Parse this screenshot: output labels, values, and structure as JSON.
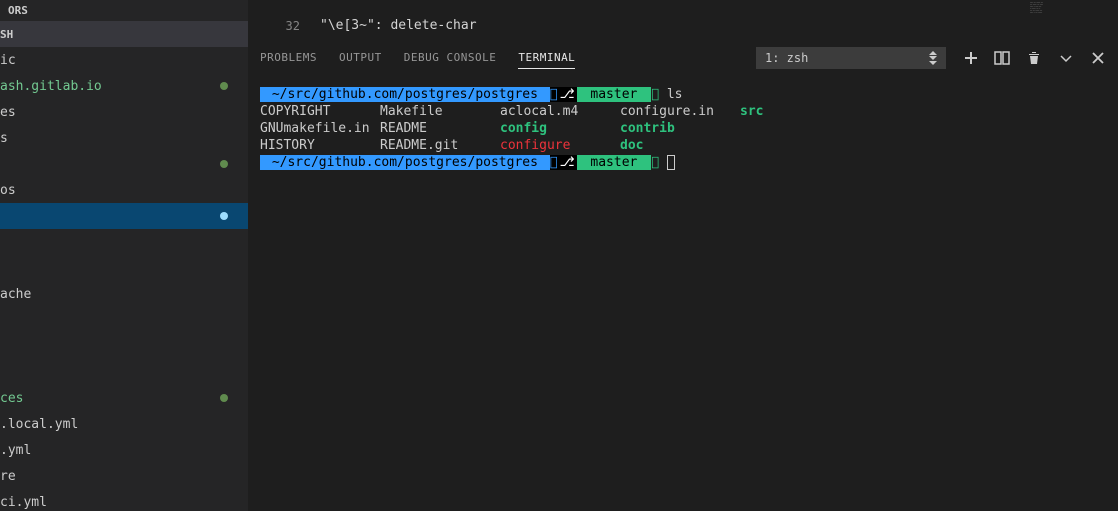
{
  "sidebar": {
    "section_ors": "ORS",
    "item_sh": "SH",
    "items": [
      "ic",
      "ash.gitlab.io",
      "es",
      "s",
      "",
      "os",
      "",
      "",
      "",
      "ache",
      "",
      "",
      "",
      "ces",
      ".local.yml",
      ".yml",
      "re",
      "ci.yml"
    ]
  },
  "editor": {
    "line0_num": "",
    "line0_text": "",
    "line1_num": "32",
    "line1_text": "\"\\e[3~\": delete-char"
  },
  "panel": {
    "tabs": [
      "PROBLEMS",
      "OUTPUT",
      "DEBUG CONSOLE",
      "TERMINAL"
    ],
    "active_tab": "TERMINAL",
    "terminal_selector": "1: zsh"
  },
  "terminal": {
    "prompt_path": " ~/src/github.com/postgres/postgres ",
    "prompt_branch": " master ",
    "cmd1": " ls",
    "ls_output": [
      [
        "COPYRIGHT",
        "Makefile",
        "aclocal.m4",
        "configure.in",
        "src"
      ],
      [
        "GNUmakefile.in",
        "README",
        "config",
        "contrib",
        ""
      ],
      [
        "HISTORY",
        "README.git",
        "configure",
        "doc",
        ""
      ]
    ],
    "ls_types": [
      [
        "file",
        "file",
        "file",
        "file",
        "dir"
      ],
      [
        "file",
        "file",
        "dir",
        "dir",
        ""
      ],
      [
        "file",
        "file",
        "exec",
        "dir",
        ""
      ]
    ]
  },
  "colors": {
    "bg": "#1e1e1e",
    "sidebar_bg": "#252526",
    "selected": "#094771",
    "highlighted": "#37373d",
    "prompt_blue": "#3399ff",
    "prompt_green": "#2ec27e",
    "dir_teal": "#2ec27e",
    "exec_red": "#ed333b"
  }
}
